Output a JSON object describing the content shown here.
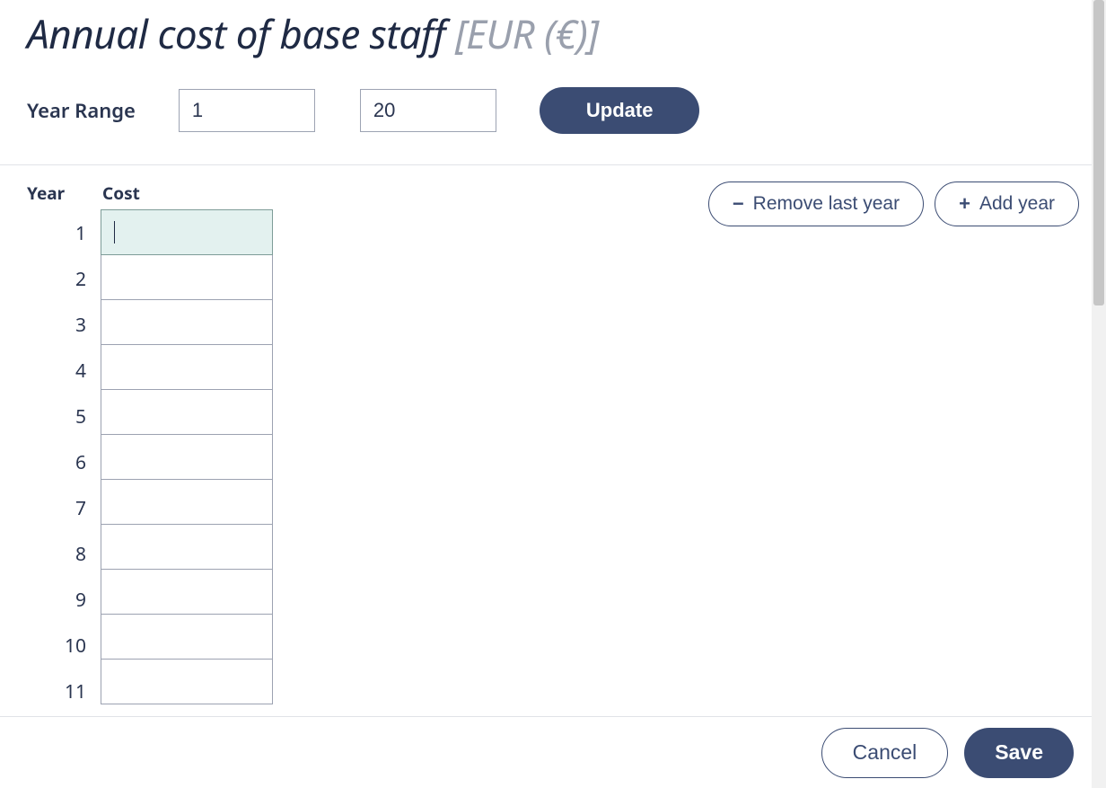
{
  "heading": {
    "title": "Annual cost of base staff ",
    "unit": "[EUR (€)]"
  },
  "range": {
    "label": "Year Range",
    "from": "1",
    "to": "20",
    "update_label": "Update"
  },
  "columns": {
    "year": "Year",
    "cost": "Cost"
  },
  "actions": {
    "remove_label": "Remove last year",
    "add_label": "Add year"
  },
  "rows": [
    {
      "year": "1",
      "cost": "",
      "active": true
    },
    {
      "year": "2",
      "cost": "",
      "active": false
    },
    {
      "year": "3",
      "cost": "",
      "active": false
    },
    {
      "year": "4",
      "cost": "",
      "active": false
    },
    {
      "year": "5",
      "cost": "",
      "active": false
    },
    {
      "year": "6",
      "cost": "",
      "active": false
    },
    {
      "year": "7",
      "cost": "",
      "active": false
    },
    {
      "year": "8",
      "cost": "",
      "active": false
    },
    {
      "year": "9",
      "cost": "",
      "active": false
    },
    {
      "year": "10",
      "cost": "",
      "active": false
    },
    {
      "year": "11",
      "cost": "",
      "active": false
    }
  ],
  "footer": {
    "cancel": "Cancel",
    "save": "Save"
  }
}
